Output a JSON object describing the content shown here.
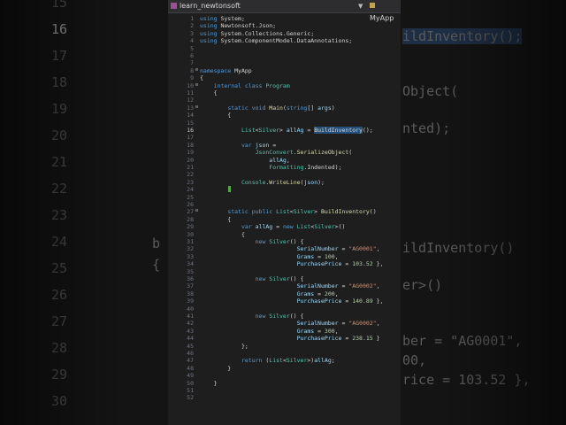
{
  "tab": {
    "title": "learn_newtonsoft",
    "nav_right": "MyApp"
  },
  "bg_left": {
    "line_numbers": [
      "15",
      "16",
      "17",
      "18",
      "19",
      "20",
      "21",
      "22",
      "23",
      "24",
      "25",
      "26",
      "27",
      "28",
      "29",
      "30"
    ],
    "fragments": [
      "b",
      "{"
    ]
  },
  "bg_right": {
    "lines": [
      "ildInventory();",
      "Object(",
      "nted);",
      "ildInventory()",
      "er>()",
      "ber = \"AG0001\",",
      "00,",
      "rice = 103.52 },"
    ]
  },
  "code": {
    "lines": [
      {
        "n": "1",
        "t": [
          [
            "k",
            "using "
          ],
          [
            "",
            "System;"
          ]
        ]
      },
      {
        "n": "2",
        "t": [
          [
            "k",
            "using "
          ],
          [
            "",
            "Newtonsoft.Json;"
          ]
        ]
      },
      {
        "n": "3",
        "t": [
          [
            "k",
            "using "
          ],
          [
            "",
            "System.Collections.Generic;"
          ]
        ]
      },
      {
        "n": "4",
        "t": [
          [
            "k",
            "using "
          ],
          [
            "",
            "System.ComponentModel.DataAnnotations;"
          ]
        ]
      },
      {
        "n": "5",
        "t": []
      },
      {
        "n": "6",
        "t": []
      },
      {
        "n": "7",
        "t": []
      },
      {
        "n": "8",
        "t": [
          [
            "k",
            "namespace "
          ],
          [
            "",
            "MyApp"
          ]
        ]
      },
      {
        "n": "9",
        "t": [
          [
            "",
            "{"
          ]
        ]
      },
      {
        "n": "10",
        "t": [
          [
            "",
            "    "
          ],
          [
            "k",
            "internal class "
          ],
          [
            "t",
            "Program"
          ]
        ]
      },
      {
        "n": "11",
        "t": [
          [
            "",
            "    {"
          ]
        ]
      },
      {
        "n": "12",
        "t": []
      },
      {
        "n": "13",
        "t": [
          [
            "",
            "        "
          ],
          [
            "k",
            "static void "
          ],
          [
            "m",
            "Main"
          ],
          [
            "",
            "("
          ],
          [
            "k",
            "string"
          ],
          [
            "",
            "[] "
          ],
          [
            "v",
            "args"
          ],
          [
            "",
            ")"
          ]
        ]
      },
      {
        "n": "14",
        "t": [
          [
            "",
            "        {"
          ]
        ]
      },
      {
        "n": "15",
        "t": []
      },
      {
        "n": "16",
        "t": [
          [
            "",
            "            "
          ],
          [
            "t",
            "List"
          ],
          [
            "",
            "<"
          ],
          [
            "t",
            "Silver"
          ],
          [
            "",
            "> "
          ],
          [
            "v",
            "allAg"
          ],
          [
            "",
            " = "
          ],
          [
            "hl",
            "BuildInventory"
          ],
          [
            "",
            "();"
          ]
        ]
      },
      {
        "n": "17",
        "t": []
      },
      {
        "n": "18",
        "t": [
          [
            "",
            "            "
          ],
          [
            "k",
            "var "
          ],
          [
            "v",
            "json"
          ],
          [
            "",
            " ="
          ]
        ]
      },
      {
        "n": "19",
        "t": [
          [
            "",
            "                "
          ],
          [
            "t",
            "JsonConvert"
          ],
          [
            "",
            "."
          ],
          [
            "m",
            "SerializeObject"
          ],
          [
            "",
            "("
          ]
        ]
      },
      {
        "n": "20",
        "t": [
          [
            "",
            "                    "
          ],
          [
            "v",
            "allAg"
          ],
          [
            "",
            ","
          ]
        ]
      },
      {
        "n": "21",
        "t": [
          [
            "",
            "                    "
          ],
          [
            "t",
            "Formatting"
          ],
          [
            "",
            ".Indented);"
          ]
        ]
      },
      {
        "n": "22",
        "t": []
      },
      {
        "n": "23",
        "t": [
          [
            "",
            "            "
          ],
          [
            "t",
            "Console"
          ],
          [
            "",
            "."
          ],
          [
            "m",
            "WriteLine"
          ],
          [
            "",
            "("
          ],
          [
            "v",
            "json"
          ],
          [
            "",
            ");"
          ]
        ]
      },
      {
        "n": "24",
        "t": [
          [
            "",
            "        }"
          ]
        ]
      },
      {
        "n": "25",
        "t": []
      },
      {
        "n": "26",
        "t": []
      },
      {
        "n": "27",
        "t": [
          [
            "",
            "        "
          ],
          [
            "k",
            "static public "
          ],
          [
            "t",
            "List"
          ],
          [
            "",
            "<"
          ],
          [
            "t",
            "Silver"
          ],
          [
            "",
            "> "
          ],
          [
            "m",
            "BuildInventory"
          ],
          [
            "",
            "()"
          ]
        ]
      },
      {
        "n": "28",
        "t": [
          [
            "",
            "        {"
          ]
        ]
      },
      {
        "n": "29",
        "t": [
          [
            "",
            "            "
          ],
          [
            "k",
            "var "
          ],
          [
            "v",
            "allAg"
          ],
          [
            "",
            " = "
          ],
          [
            "k",
            "new "
          ],
          [
            "t",
            "List"
          ],
          [
            "",
            "<"
          ],
          [
            "t",
            "Silver"
          ],
          [
            "",
            ">()"
          ]
        ]
      },
      {
        "n": "30",
        "t": [
          [
            "",
            "            {"
          ]
        ]
      },
      {
        "n": "31",
        "t": [
          [
            "",
            "                "
          ],
          [
            "k",
            "new "
          ],
          [
            "t",
            "Silver"
          ],
          [
            "",
            "() {"
          ]
        ]
      },
      {
        "n": "32",
        "t": [
          [
            "",
            "                            "
          ],
          [
            "v",
            "SerialNumber"
          ],
          [
            "",
            " = "
          ],
          [
            "s",
            "\"AG0001\""
          ],
          [
            "",
            ","
          ]
        ]
      },
      {
        "n": "33",
        "t": [
          [
            "",
            "                            "
          ],
          [
            "v",
            "Grams"
          ],
          [
            "",
            " = "
          ],
          [
            "n",
            "100"
          ],
          [
            "",
            ","
          ]
        ]
      },
      {
        "n": "34",
        "t": [
          [
            "",
            "                            "
          ],
          [
            "v",
            "PurchasePrice"
          ],
          [
            "",
            " = "
          ],
          [
            "n",
            "103.52"
          ],
          [
            "",
            " },"
          ]
        ]
      },
      {
        "n": "35",
        "t": []
      },
      {
        "n": "36",
        "t": [
          [
            "",
            "                "
          ],
          [
            "k",
            "new "
          ],
          [
            "t",
            "Silver"
          ],
          [
            "",
            "() {"
          ]
        ]
      },
      {
        "n": "37",
        "t": [
          [
            "",
            "                            "
          ],
          [
            "v",
            "SerialNumber"
          ],
          [
            "",
            " = "
          ],
          [
            "s",
            "\"AG0002\""
          ],
          [
            "",
            ","
          ]
        ]
      },
      {
        "n": "38",
        "t": [
          [
            "",
            "                            "
          ],
          [
            "v",
            "Grams"
          ],
          [
            "",
            " = "
          ],
          [
            "n",
            "200"
          ],
          [
            "",
            ","
          ]
        ]
      },
      {
        "n": "39",
        "t": [
          [
            "",
            "                            "
          ],
          [
            "v",
            "PurchasePrice"
          ],
          [
            "",
            " = "
          ],
          [
            "n",
            "140.89"
          ],
          [
            "",
            " },"
          ]
        ]
      },
      {
        "n": "40",
        "t": []
      },
      {
        "n": "41",
        "t": [
          [
            "",
            "                "
          ],
          [
            "k",
            "new "
          ],
          [
            "t",
            "Silver"
          ],
          [
            "",
            "() {"
          ]
        ]
      },
      {
        "n": "42",
        "t": [
          [
            "",
            "                            "
          ],
          [
            "v",
            "SerialNumber"
          ],
          [
            "",
            " = "
          ],
          [
            "s",
            "\"AG0002\""
          ],
          [
            "",
            ","
          ]
        ]
      },
      {
        "n": "43",
        "t": [
          [
            "",
            "                            "
          ],
          [
            "v",
            "Grams"
          ],
          [
            "",
            " = "
          ],
          [
            "n",
            "300"
          ],
          [
            "",
            ","
          ]
        ]
      },
      {
        "n": "44",
        "t": [
          [
            "",
            "                            "
          ],
          [
            "v",
            "PurchasePrice"
          ],
          [
            "",
            " = "
          ],
          [
            "n",
            "238.15"
          ],
          [
            "",
            " }"
          ]
        ]
      },
      {
        "n": "45",
        "t": [
          [
            "",
            "            };"
          ]
        ]
      },
      {
        "n": "46",
        "t": []
      },
      {
        "n": "47",
        "t": [
          [
            "",
            "            "
          ],
          [
            "k",
            "return "
          ],
          [
            "",
            "("
          ],
          [
            "t",
            "List"
          ],
          [
            "",
            "<"
          ],
          [
            "t",
            "Silver"
          ],
          [
            "",
            ">)"
          ],
          [
            "v",
            "allAg"
          ],
          [
            "",
            ";"
          ]
        ]
      },
      {
        "n": "48",
        "t": [
          [
            "",
            "        }"
          ]
        ]
      },
      {
        "n": "49",
        "t": []
      },
      {
        "n": "50",
        "t": [
          [
            "",
            "    }"
          ]
        ]
      },
      {
        "n": "51",
        "t": []
      },
      {
        "n": "52",
        "t": []
      }
    ]
  }
}
